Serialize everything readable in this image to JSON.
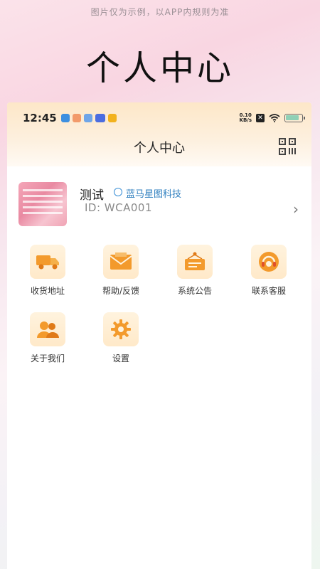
{
  "top_caption": "图片仅为示例，以APP内规则为准",
  "hero_title": "个人中心",
  "statusbar": {
    "time": "12:45",
    "net_speed_top": "0.10",
    "net_speed_bottom": "KB/s"
  },
  "nav": {
    "title": "个人中心"
  },
  "profile": {
    "name": "测试",
    "company": "蓝马星图科技",
    "id_text": "ID:  WCA001"
  },
  "menu": [
    {
      "label": "收货地址",
      "icon": "truck-icon"
    },
    {
      "label": "帮助/反馈",
      "icon": "envelope-icon"
    },
    {
      "label": "系统公告",
      "icon": "notice-board-icon"
    },
    {
      "label": "联系客服",
      "icon": "headset-icon"
    },
    {
      "label": "关于我们",
      "icon": "users-icon"
    },
    {
      "label": "设置",
      "icon": "gear-icon"
    }
  ],
  "colors": {
    "accent": "#f39a2c",
    "tile_bg": "#ffeccd",
    "link_blue": "#2f7fbf"
  }
}
